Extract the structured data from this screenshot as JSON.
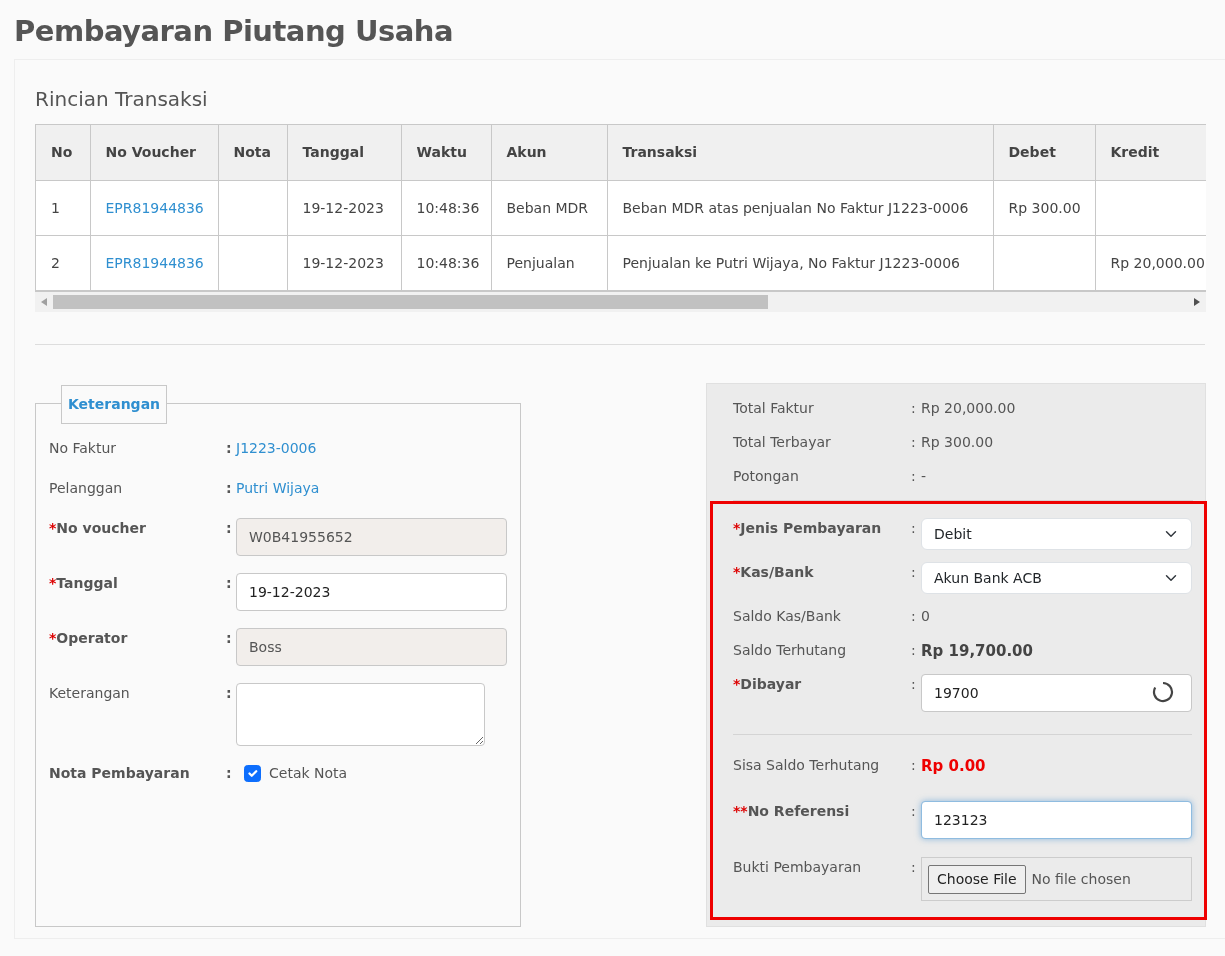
{
  "page_title": "Pembayaran Piutang Usaha",
  "transactions": {
    "title": "Rincian Transaksi",
    "columns": [
      "No",
      "No Voucher",
      "Nota",
      "Tanggal",
      "Waktu",
      "Akun",
      "Transaksi",
      "Debet",
      "Kredit"
    ],
    "rows": [
      {
        "no": "1",
        "voucher": "EPR81944836",
        "tanggal": "19-12-2023",
        "waktu": "10:48:36",
        "akun": "Beban MDR",
        "transaksi": "Beban MDR atas penjualan No Faktur J1223-0006",
        "debet": "Rp 300.00"
      },
      {
        "no": "2",
        "voucher": "EPR81944836",
        "tanggal": "19-12-2023",
        "waktu": "10:48:36",
        "akun": "Penjualan",
        "transaksi": "Penjualan ke Putri Wijaya, No Faktur J1223-0006",
        "kredit": "Rp 20,000.00"
      }
    ]
  },
  "keterangan": {
    "legend": "Keterangan",
    "rows": [
      {
        "kind": "link",
        "label": "No Faktur",
        "separator": ":",
        "bold": false,
        "value": "J1223-0006"
      },
      {
        "kind": "link",
        "label": "Pelanggan",
        "separator": ":",
        "bold": false,
        "value": "Putri Wijaya"
      },
      {
        "kind": "input",
        "label": "No voucher",
        "required_mark": "*",
        "separator": ":",
        "bold": true,
        "value": "W0B41955652",
        "readonly": true
      },
      {
        "kind": "input",
        "label": "Tanggal",
        "required_mark": "*",
        "separator": ":",
        "bold": true,
        "value": "19-12-2023",
        "readonly": false
      },
      {
        "kind": "input",
        "label": "Operator",
        "required_mark": "*",
        "separator": ":",
        "bold": true,
        "value": "Boss",
        "readonly": true
      },
      {
        "kind": "textarea",
        "label": "Keterangan",
        "separator": ":",
        "bold": false
      },
      {
        "kind": "checkbox",
        "label": "Nota Pembayaran",
        "separator": ":",
        "bold": true,
        "option": "Cetak Nota",
        "checked": true
      }
    ]
  },
  "summary": {
    "rows": [
      {
        "kind": "text",
        "label": "Total Faktur",
        "separator": ":",
        "value": "Rp 20,000.00"
      },
      {
        "kind": "text",
        "label": "Total Terbayar",
        "separator": ":",
        "value": "Rp 300.00"
      },
      {
        "kind": "text",
        "label": "Potongan",
        "separator": ":",
        "value": "-"
      }
    ]
  },
  "payment": {
    "rows": [
      {
        "kind": "select",
        "label": "Jenis Pembayaran",
        "required_mark": "*",
        "separator": ":",
        "value": "Debit"
      },
      {
        "kind": "select",
        "label": "Kas/Bank",
        "required_mark": "*",
        "separator": ":",
        "value": "Akun Bank ACB"
      },
      {
        "kind": "text",
        "label": "Saldo Kas/Bank",
        "separator": ":",
        "value": "0"
      },
      {
        "kind": "text",
        "label": "Saldo Terhutang",
        "separator": ":",
        "value": "Rp 19,700.00",
        "strong": true
      },
      {
        "kind": "input",
        "label": "Dibayar",
        "required_mark": "*",
        "separator": ":",
        "value": "19700",
        "loading": true,
        "focused": false
      },
      {
        "kind": "divider"
      },
      {
        "kind": "text",
        "label": "Sisa Saldo Terhutang",
        "separator": ":",
        "value": "Rp 0.00",
        "strong": true,
        "alert": true
      },
      {
        "kind": "input",
        "label": "No Referensi",
        "required_mark": "**",
        "separator": ":",
        "value": "123123",
        "loading": false,
        "focused": true
      },
      {
        "kind": "file",
        "label": "Bukti Pembayaran",
        "separator": ":",
        "button": "Choose File",
        "status": "No file chosen"
      }
    ]
  }
}
